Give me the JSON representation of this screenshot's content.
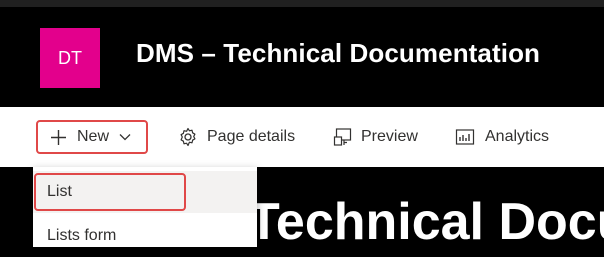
{
  "header": {
    "logo_initials": "DT",
    "site_title": "DMS – Technical Documentation",
    "brand_color": "#e3008c"
  },
  "command_bar": {
    "new_label": "New",
    "new_icon": "plus-icon",
    "page_details_label": "Page details",
    "page_details_icon": "gear-icon",
    "preview_label": "Preview",
    "preview_icon": "preview-icon",
    "analytics_label": "Analytics",
    "analytics_icon": "analytics-icon"
  },
  "new_menu": {
    "items": [
      {
        "label": "List"
      },
      {
        "label": "Lists form"
      }
    ]
  },
  "page": {
    "title_fragment": "Technical Docu"
  },
  "highlight_color": "#e04848"
}
